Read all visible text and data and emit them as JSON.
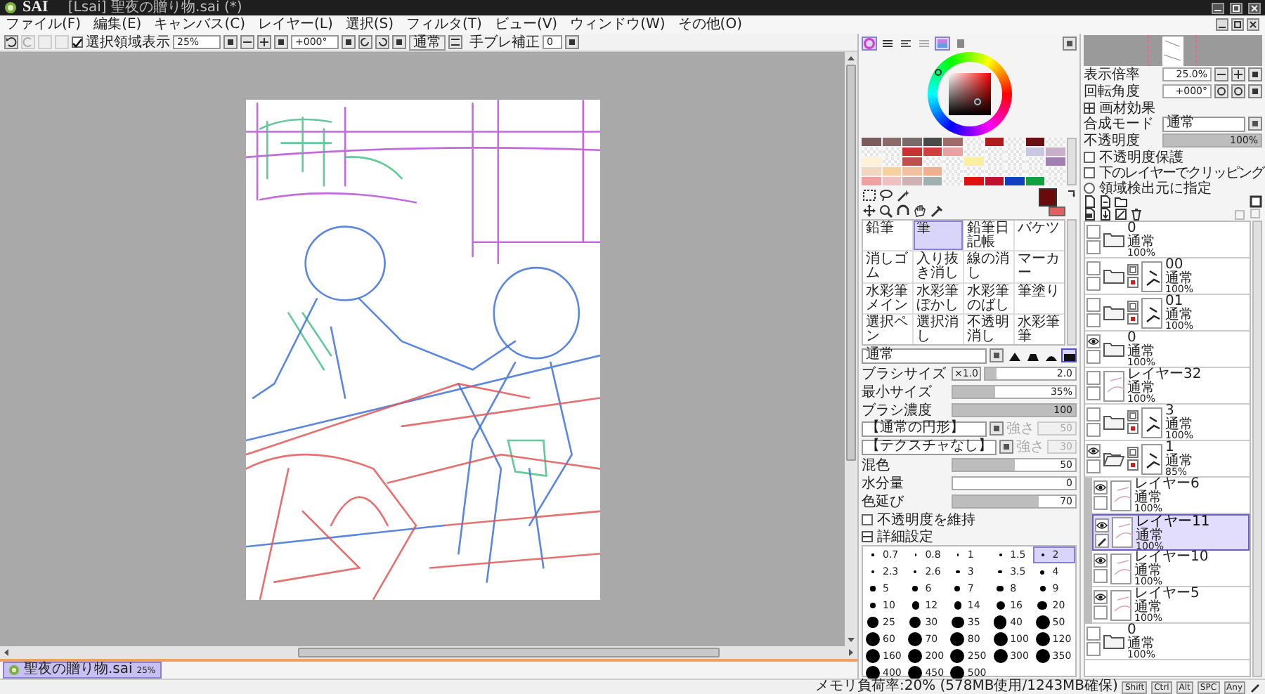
{
  "window": {
    "app_name": "SAI",
    "title": "[Lsai] 聖夜の贈り物.sai (*)"
  },
  "menu": [
    "ファイル(F)",
    "編集(E)",
    "キャンバス(C)",
    "レイヤー(L)",
    "選択(S)",
    "フィルタ(T)",
    "ビュー(V)",
    "ウィンドウ(W)",
    "その他(O)"
  ],
  "toolbar": {
    "selection_display": {
      "label": "選択領域表示",
      "checked": true
    },
    "zoom": "25%",
    "rotation": "+000°",
    "view_mode": "通常",
    "stabilizer": {
      "label": "手ブレ補正",
      "value": "0"
    }
  },
  "documents": [
    {
      "name": "聖夜の贈り物.sai",
      "zoom": "25%",
      "selected": true
    }
  ],
  "color_panel": {
    "tabs": [
      {
        "on": true
      },
      {
        "on": false
      },
      {
        "on": false
      },
      {
        "on": false
      },
      {
        "on": true
      },
      {
        "on": false
      }
    ],
    "swatches": [
      {
        "kind": "color",
        "color": "#7a5c5c"
      },
      {
        "kind": "color",
        "color": "#8c6a6a"
      },
      {
        "kind": "color",
        "color": "#7a6a6a"
      },
      {
        "kind": "color",
        "color": "#4a4a4a"
      },
      {
        "kind": "color",
        "color": "#a06a6a"
      },
      {
        "kind": "empty"
      },
      {
        "kind": "color",
        "color": "#b01c1c"
      },
      {
        "kind": "empty"
      },
      {
        "kind": "color",
        "color": "#6a1010"
      },
      {
        "kind": "empty"
      },
      {
        "kind": "empty"
      },
      {
        "kind": "empty"
      },
      {
        "kind": "color",
        "color": "#c83232"
      },
      {
        "kind": "color",
        "color": "#d04040"
      },
      {
        "kind": "color",
        "color": "#e8a0a0"
      },
      {
        "kind": "empty"
      },
      {
        "kind": "empty"
      },
      {
        "kind": "empty"
      },
      {
        "kind": "color",
        "color": "#c8c8e0"
      },
      {
        "kind": "color",
        "color": "#c8b0c8"
      },
      {
        "kind": "color",
        "color": "#fff0d8"
      },
      {
        "kind": "empty"
      },
      {
        "kind": "color",
        "color": "#c05050"
      },
      {
        "kind": "empty"
      },
      {
        "kind": "empty"
      },
      {
        "kind": "color",
        "color": "#f8f0a0"
      },
      {
        "kind": "empty"
      },
      {
        "kind": "empty"
      },
      {
        "kind": "empty"
      },
      {
        "kind": "color",
        "color": "#a080b0"
      },
      {
        "kind": "color",
        "color": "#f0d8c0"
      },
      {
        "kind": "color",
        "color": "#f8d0a0"
      },
      {
        "kind": "color",
        "color": "#f0c0a0"
      },
      {
        "kind": "color",
        "color": "#f0b090"
      },
      {
        "kind": "empty"
      },
      {
        "kind": "empty"
      },
      {
        "kind": "empty"
      },
      {
        "kind": "empty"
      },
      {
        "kind": "empty"
      },
      {
        "kind": "empty"
      },
      {
        "kind": "color",
        "color": "#f0a0a0"
      },
      {
        "kind": "color",
        "color": "#f0c0c0"
      },
      {
        "kind": "color",
        "color": "#d0b0b0"
      },
      {
        "kind": "color",
        "color": "#a0b0b0"
      },
      {
        "kind": "empty"
      },
      {
        "kind": "color",
        "color": "#e01010"
      },
      {
        "kind": "color",
        "color": "#c01030"
      },
      {
        "kind": "color",
        "color": "#1040c0"
      },
      {
        "kind": "color",
        "color": "#10a040"
      },
      {
        "kind": "empty"
      }
    ],
    "foreground": {
      "color": "#6a0a0a"
    },
    "background": {
      "color": "#e06060"
    }
  },
  "brushes": [
    {
      "name": "鉛筆",
      "selected": false
    },
    {
      "name": "筆",
      "selected": true
    },
    {
      "name": "鉛筆日記帳",
      "selected": false
    },
    {
      "name": "バケツ",
      "selected": false
    },
    {
      "name": "消しゴム",
      "selected": false
    },
    {
      "name": "入り抜き消し",
      "selected": false
    },
    {
      "name": "線の消し",
      "selected": false
    },
    {
      "name": "マーカー",
      "selected": false
    },
    {
      "name": "水彩筆メイン",
      "selected": false
    },
    {
      "name": "水彩筆ぼかし",
      "selected": false
    },
    {
      "name": "水彩筆のばし",
      "selected": false
    },
    {
      "name": "筆塗り",
      "selected": false
    },
    {
      "name": "選択ペン",
      "selected": false
    },
    {
      "name": "選択消し",
      "selected": false
    },
    {
      "name": "不透明消し",
      "selected": false
    },
    {
      "name": "水彩筆筆",
      "selected": false
    }
  ],
  "brush_settings": {
    "mode": "通常",
    "shapes": [
      {
        "selected": false
      },
      {
        "selected": false
      },
      {
        "selected": false
      },
      {
        "selected": true
      }
    ],
    "sliders": [
      {
        "label": "ブラシサイズ",
        "prefix": "×1.0",
        "value": "2.0",
        "level": 0.12
      },
      {
        "label": "最小サイズ",
        "value": "35%",
        "level": 0.35
      },
      {
        "label": "ブラシ濃度",
        "value": "100",
        "level": 1
      }
    ],
    "dropdowns": [
      {
        "value": "【通常の円形】",
        "label": "強さ",
        "amount": "50",
        "disabled": true
      },
      {
        "value": "【テクスチャなし】",
        "label": "強さ",
        "amount": "30",
        "disabled": true
      }
    ],
    "mixing": [
      {
        "label": "混色",
        "value": "50",
        "level": 0.5
      },
      {
        "label": "水分量",
        "value": "0",
        "level": 0
      },
      {
        "label": "色延び",
        "value": "70",
        "level": 0.7
      }
    ],
    "keep_opacity": {
      "label": "不透明度を維持",
      "checked": false
    },
    "details": {
      "label": "詳細設定",
      "expanded": true
    }
  },
  "brush_sizes": [
    {
      "value": "0.7",
      "selected": false
    },
    {
      "value": "0.8",
      "selected": false
    },
    {
      "value": "1",
      "selected": false
    },
    {
      "value": "1.5",
      "selected": false
    },
    {
      "value": "2",
      "selected": true
    },
    {
      "value": "2.3",
      "selected": false
    },
    {
      "value": "2.6",
      "selected": false
    },
    {
      "value": "3",
      "selected": false
    },
    {
      "value": "3.5",
      "selected": false
    },
    {
      "value": "4",
      "selected": false
    },
    {
      "value": "5",
      "selected": false
    },
    {
      "value": "6",
      "selected": false
    },
    {
      "value": "7",
      "selected": false
    },
    {
      "value": "8",
      "selected": false
    },
    {
      "value": "9",
      "selected": false
    },
    {
      "value": "10",
      "selected": false
    },
    {
      "value": "12",
      "selected": false
    },
    {
      "value": "14",
      "selected": false
    },
    {
      "value": "16",
      "selected": false
    },
    {
      "value": "20",
      "selected": false
    },
    {
      "value": "25",
      "selected": false
    },
    {
      "value": "30",
      "selected": false
    },
    {
      "value": "35",
      "selected": false
    },
    {
      "value": "40",
      "selected": false
    },
    {
      "value": "50",
      "selected": false
    },
    {
      "value": "60",
      "selected": false
    },
    {
      "value": "70",
      "selected": false
    },
    {
      "value": "80",
      "selected": false
    },
    {
      "value": "100",
      "selected": false
    },
    {
      "value": "120",
      "selected": false
    },
    {
      "value": "160",
      "selected": false
    },
    {
      "value": "200",
      "selected": false
    },
    {
      "value": "250",
      "selected": false
    },
    {
      "value": "300",
      "selected": false
    },
    {
      "value": "350",
      "selected": false
    },
    {
      "value": "400",
      "selected": false
    },
    {
      "value": "450",
      "selected": false
    },
    {
      "value": "500",
      "selected": false
    }
  ],
  "navigator": {
    "zoom_label": "表示倍率",
    "zoom": "25.0%",
    "rotation_label": "回転角度",
    "rotation": "+000°"
  },
  "layer_settings": {
    "effects_label": "画材効果",
    "blend_label": "合成モード",
    "blend": "通常",
    "opacity_label": "不透明度",
    "opacity": "100%",
    "level": 1,
    "options": [
      {
        "kind": "checkbox",
        "label": "不透明度保護",
        "checked": false
      },
      {
        "kind": "checkbox",
        "label": "下のレイヤーでクリッピング",
        "checked": false
      },
      {
        "kind": "radio",
        "label": "領域検出元に指定",
        "checked": false
      }
    ]
  },
  "layers": [
    {
      "kind": "folder",
      "name": "0",
      "mode": "通常",
      "opacity": "100%",
      "visible": false,
      "masked": false,
      "expanded": false,
      "selected": false
    },
    {
      "kind": "folder",
      "name": "00",
      "mode": "通常",
      "opacity": "100%",
      "visible": false,
      "masked": true,
      "expanded": false,
      "selected": false
    },
    {
      "kind": "folder",
      "name": "01",
      "mode": "通常",
      "opacity": "100%",
      "visible": false,
      "masked": true,
      "expanded": false,
      "selected": false
    },
    {
      "kind": "folder",
      "name": "0",
      "mode": "通常",
      "opacity": "100%",
      "visible": true,
      "masked": false,
      "expanded": false,
      "selected": false
    },
    {
      "kind": "layer",
      "name": "レイヤー32",
      "mode": "通常",
      "opacity": "100%",
      "visible": false,
      "selected": false
    },
    {
      "kind": "folder",
      "name": "3",
      "mode": "通常",
      "opacity": "100%",
      "visible": false,
      "masked": true,
      "expanded": false,
      "selected": false
    },
    {
      "kind": "folder",
      "name": "1",
      "mode": "通常",
      "opacity": "85%",
      "visible": true,
      "masked": true,
      "expanded": true,
      "selected": false,
      "children": [
        {
          "kind": "layer",
          "name": "レイヤー6",
          "mode": "通常",
          "opacity": "100%",
          "visible": true,
          "selected": false
        },
        {
          "kind": "layer",
          "name": "レイヤー11",
          "mode": "通常",
          "opacity": "100%",
          "visible": true,
          "selected": true
        },
        {
          "kind": "layer",
          "name": "レイヤー10",
          "mode": "通常",
          "opacity": "100%",
          "visible": true,
          "selected": false
        },
        {
          "kind": "layer",
          "name": "レイヤー5",
          "mode": "通常",
          "opacity": "100%",
          "visible": true,
          "selected": false
        }
      ]
    },
    {
      "kind": "folder",
      "name": "0",
      "mode": "通常",
      "opacity": "100%",
      "visible": false,
      "masked": false,
      "expanded": false,
      "selected": false
    }
  ],
  "status_bar": {
    "memory": "メモリ負荷率:20% (578MB使用/1243MB確保)",
    "keys": [
      "Shift",
      "Ctrl",
      "Alt",
      "SPC",
      "Any"
    ]
  }
}
